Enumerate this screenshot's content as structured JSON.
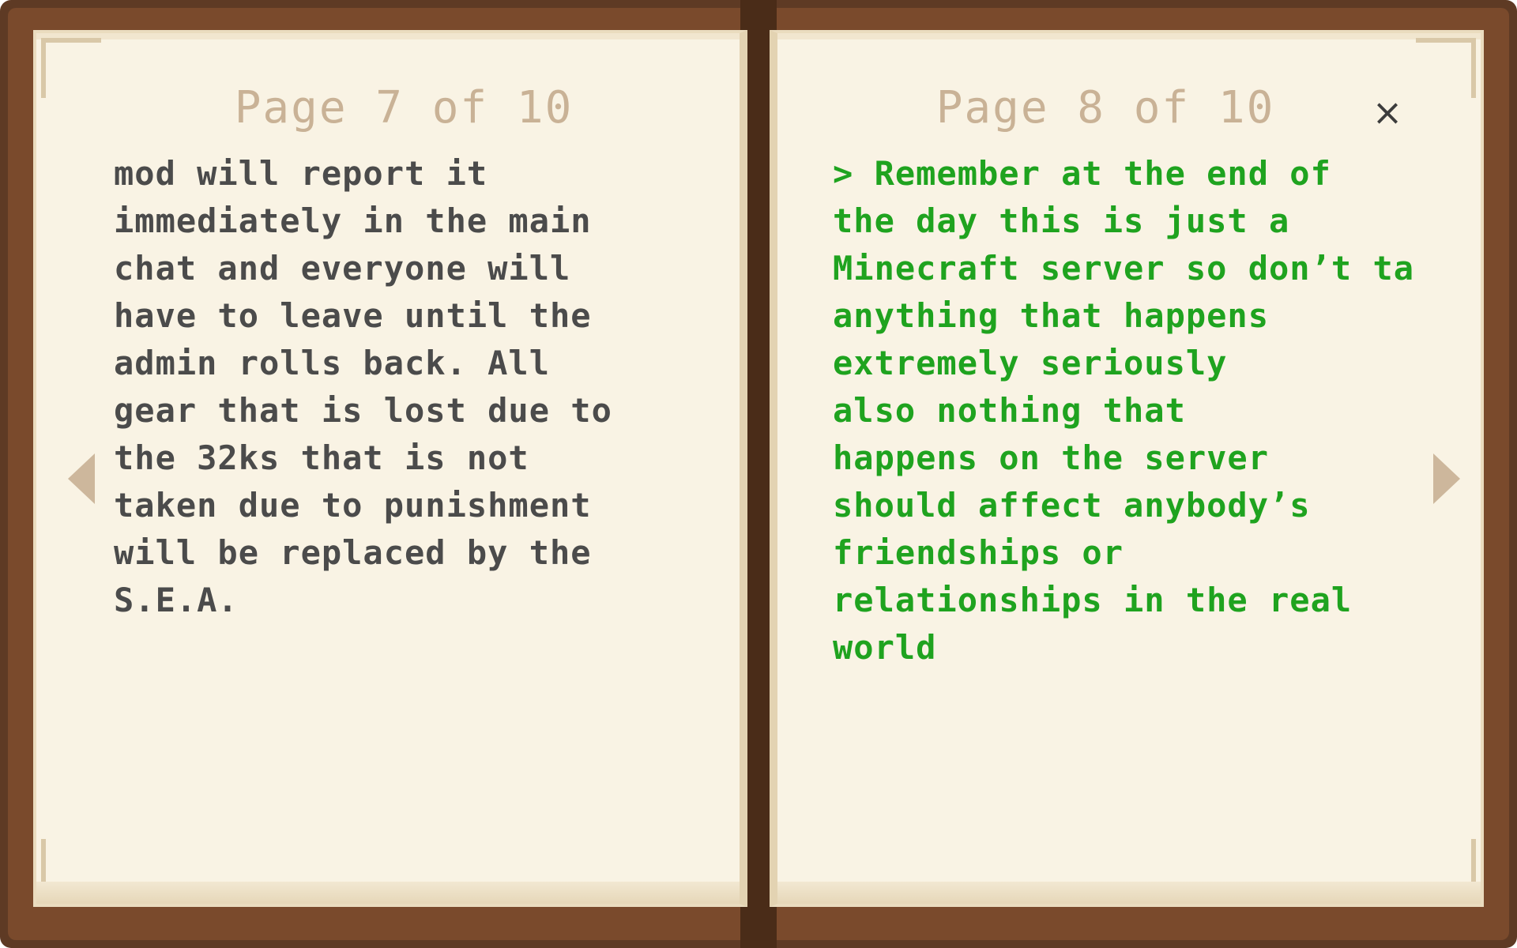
{
  "book": {
    "left_page": {
      "header": "Page 7 of 10",
      "text": "mod will report it\nimmediately in the main\nchat and everyone will\nhave to leave until the\nadmin rolls back. All\ngear that is lost due to\nthe 32ks that is not\ntaken due to punishment\nwill be replaced by the\nS.E.A."
    },
    "right_page": {
      "header": "Page 8 of 10",
      "text": "> Remember at the end of\nthe day this is just a\nMinecraft server so don’t ta\nanything that happens\nextremely seriously\nalso nothing that\nhappens on the server\nshould affect anybody’s\nfriendships or\nrelationships in the real\nworld"
    },
    "close_glyph": "×",
    "prev_arrow_icon": "triangle-left-icon",
    "next_arrow_icon": "triangle-right-icon"
  },
  "colors": {
    "cover": "#5e3a24",
    "paper": "#f9f3e4",
    "header_text": "#c9b296",
    "left_text": "#4b4b4b",
    "right_text": "#1fa31f"
  }
}
